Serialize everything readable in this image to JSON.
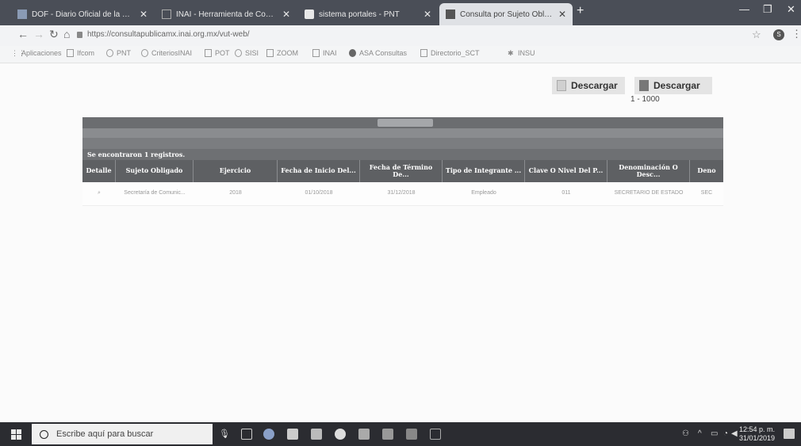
{
  "browser": {
    "tabs": [
      {
        "label": "DOF - Diario Oficial de la Federa",
        "active": false
      },
      {
        "label": "INAI - Herramienta de Comunic",
        "active": false
      },
      {
        "label": "sistema portales - PNT",
        "active": false
      },
      {
        "label": "Consulta por Sujeto Obligado",
        "active": true
      }
    ],
    "url": "https://consultapublicamx.inai.org.mx/vut-web/",
    "profile_initial": "S"
  },
  "bookmarks": [
    {
      "label": "Aplicaciones",
      "icon": "apps-grid-icon"
    },
    {
      "label": "Ifcom",
      "icon": "page-icon"
    },
    {
      "label": "PNT",
      "icon": "pnt-icon"
    },
    {
      "label": "CriteriosINAI",
      "icon": "criteria-icon"
    },
    {
      "label": "POT",
      "icon": "pot-icon"
    },
    {
      "label": "SISI",
      "icon": "person-icon"
    },
    {
      "label": "ZOOM",
      "icon": "page-icon"
    },
    {
      "label": "INAI",
      "icon": "page-icon"
    },
    {
      "label": "ASA Consultas",
      "icon": "circle-icon"
    },
    {
      "label": "Directorio_SCT",
      "icon": "directory-icon"
    },
    {
      "label": "INSU",
      "icon": "insu-icon"
    }
  ],
  "downloads": {
    "button1": "Descargar",
    "button2": "Descargar",
    "range": "1 - 1000"
  },
  "table": {
    "found_text": "Se encontraron 1 registros.",
    "columns": [
      "Detalle",
      "Sujeto Obligado",
      "Ejercicio",
      "Fecha de Inicio Del...",
      "Fecha de Término De...",
      "Tipo de Integrante ...",
      "Clave O Nivel Del P...",
      "Denominación O Desc...",
      "Deno"
    ],
    "rows": [
      {
        "detalle": "⌕",
        "sujeto": "Secretaría de Comunic...",
        "ejercicio": "2018",
        "inicio": "01/10/2018",
        "termino": "31/12/2018",
        "tipo": "Empleado",
        "clave": "011",
        "denominacion": "SECRETARIO DE ESTADO",
        "deno": "SEC"
      }
    ]
  },
  "taskbar": {
    "search_placeholder": "Escribe aquí para buscar",
    "time": "12:54 p. m.",
    "date": "31/01/2019"
  },
  "colors": {
    "titlebar": "#4a4e57",
    "table_header": "#5e6063",
    "taskbar": "#2b2c31"
  }
}
